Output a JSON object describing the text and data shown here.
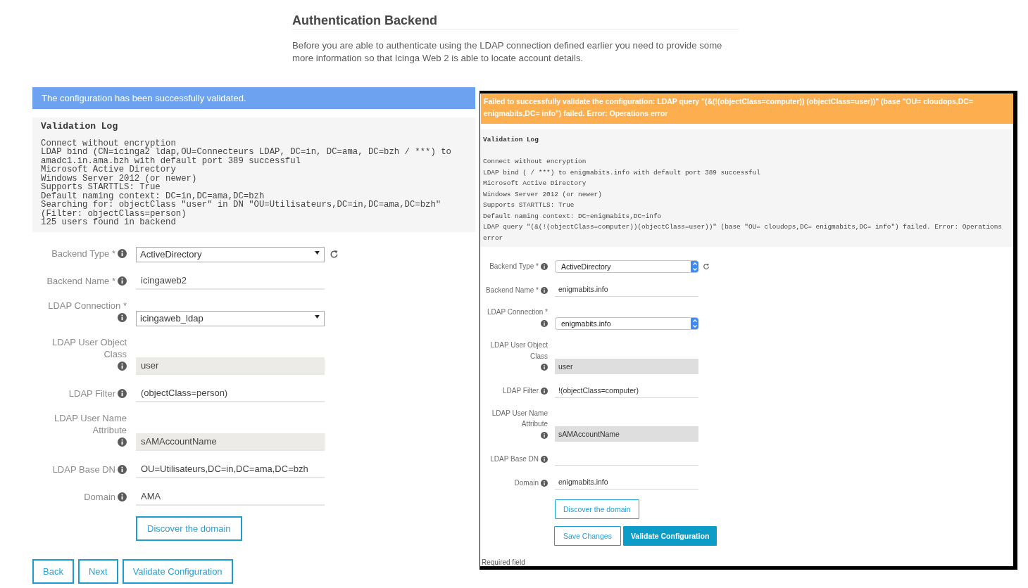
{
  "header": {
    "title": "Authentication Backend",
    "description": "Before you are able to authenticate using the LDAP connection defined earlier you need to provide some more information so that Icinga Web 2 is able to locate account details."
  },
  "panels": [
    {
      "kind": "plain",
      "notice": {
        "kind": "success",
        "text": "The configuration has been successfully validated."
      },
      "log": {
        "title": "Validation Log",
        "lines": [
          "Connect without encryption",
          "LDAP bind (CN=icinga2 ldap,OU=Connecteurs LDAP, DC=in, DC=ama, DC=bzh / ***) to amadc1.in.ama.bzh with default port 389 successful",
          "Microsoft Active Directory",
          "Windows Server 2012 (or newer)",
          "Supports STARTTLS: True",
          "Default naming context: DC=in,DC=ama,DC=bzh",
          "Searching for: objectClass \"user\" in DN \"OU=Utilisateurs,DC=in,DC=ama,DC=bzh\" (Filter: objectClass=person)",
          "125 users found in backend"
        ]
      },
      "fields": [
        {
          "kind": "autosubmit_select",
          "label": "Backend Type *",
          "value": "ActiveDirectory"
        },
        {
          "kind": "text",
          "label": "Backend Name *",
          "value": "icingaweb2"
        },
        {
          "kind": "select",
          "label": "LDAP Connection *",
          "value": "icingaweb_ldap"
        },
        {
          "kind": "readonly",
          "label": "LDAP User Object Class",
          "value": "user"
        },
        {
          "kind": "text",
          "label": "LDAP Filter",
          "value": "(objectClass=person)"
        },
        {
          "kind": "readonly",
          "label": "LDAP User Name Attribute",
          "value": "sAMAccountName"
        },
        {
          "kind": "text",
          "label": "LDAP Base DN",
          "value": "OU=Utilisateurs,DC=in,DC=ama,DC=bzh"
        },
        {
          "kind": "text",
          "label": "Domain",
          "value": "AMA"
        }
      ],
      "discover_button": "Discover the domain",
      "buttons": [
        {
          "label": "Back",
          "primary": false
        },
        {
          "label": "Next",
          "primary": false
        },
        {
          "label": "Validate Configuration",
          "primary": false
        }
      ]
    },
    {
      "kind": "framed",
      "notice": {
        "kind": "error",
        "text": "Failed to successfully validate the configuration: LDAP query \"(&(!(objectClass=computer)) (objectClass=user))\" (base \"OU= cloudops,DC= enigmabits,DC= info\") failed. Error: Operations error"
      },
      "log": {
        "title": "Validation Log",
        "lines": [
          "Connect without encryption",
          "LDAP bind ( / ***) to enigmabits.info with default port 389 successful",
          "Microsoft Active Directory",
          "Windows Server 2012 (or newer)",
          "Supports STARTTLS: True",
          "Default naming context: DC=enigmabits,DC=info",
          "LDAP query \"(&(!(objectClass=computer))(objectClass=user))\" (base \"OU= cloudops,DC= enigmabits,DC= info\") failed. Error: Operations error"
        ]
      },
      "fields": [
        {
          "kind": "autosubmit_select",
          "label": "Backend Type *",
          "value": "ActiveDirectory"
        },
        {
          "kind": "text",
          "label": "Backend Name *",
          "value": "enigmabits.info"
        },
        {
          "kind": "select",
          "label": "LDAP Connection *",
          "value": "enigmabits.info"
        },
        {
          "kind": "readonly",
          "label": "LDAP User Object Class",
          "value": "user"
        },
        {
          "kind": "text",
          "label": "LDAP Filter",
          "value": "!(objectClass=computer)"
        },
        {
          "kind": "readonly",
          "label": "LDAP User Name Attribute",
          "value": "sAMAccountName"
        },
        {
          "kind": "text",
          "label": "LDAP Base DN"
        },
        {
          "kind": "text",
          "label": "Domain",
          "value": "enigmabits.info"
        }
      ],
      "discover_button": "Discover the domain",
      "buttons": [
        {
          "label": "Save Changes",
          "primary": false
        },
        {
          "label": "Validate Configuration",
          "primary": true
        }
      ],
      "footnote": "Required field"
    }
  ]
}
